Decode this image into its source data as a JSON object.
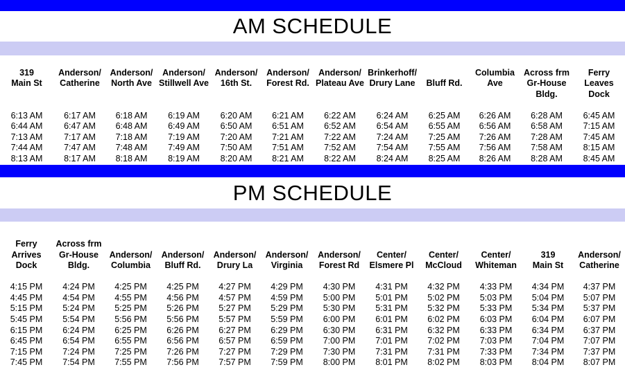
{
  "colors": {
    "rule_bar": "#0000FF",
    "band": "#CCCCF4",
    "text": "#000000",
    "background": "#FFFFFF"
  },
  "am_section": {
    "title": "AM SCHEDULE",
    "columns": [
      {
        "line1": "319",
        "line2": "Main St",
        "line3": ""
      },
      {
        "line1": "Anderson/",
        "line2": "Catherine",
        "line3": ""
      },
      {
        "line1": "Anderson/",
        "line2": "North Ave",
        "line3": ""
      },
      {
        "line1": "Anderson/",
        "line2": "Stillwell Ave",
        "line3": ""
      },
      {
        "line1": "Anderson/",
        "line2": "16th St.",
        "line3": ""
      },
      {
        "line1": "Anderson/",
        "line2": "Forest Rd.",
        "line3": ""
      },
      {
        "line1": "Anderson/",
        "line2": "Plateau Ave",
        "line3": ""
      },
      {
        "line1": "Brinkerhoff/",
        "line2": "Drury Lane",
        "line3": ""
      },
      {
        "line1": "",
        "line2": "Bluff Rd.",
        "line3": ""
      },
      {
        "line1": "Columbia",
        "line2": "Ave",
        "line3": ""
      },
      {
        "line1": "Across frm",
        "line2": "Gr-House",
        "line3": "Bldg."
      },
      {
        "line1": "Ferry",
        "line2": "Leaves",
        "line3": "Dock"
      }
    ],
    "rows": [
      [
        "6:13 AM",
        "6:17 AM",
        "6:18 AM",
        "6:19 AM",
        "6:20 AM",
        "6:21 AM",
        "6:22 AM",
        "6:24 AM",
        "6:25 AM",
        "6:26 AM",
        "6:28 AM",
        "6:45 AM"
      ],
      [
        "6:44 AM",
        "6:47 AM",
        "6:48 AM",
        "6:49 AM",
        "6:50 AM",
        "6:51 AM",
        "6:52 AM",
        "6:54 AM",
        "6:55 AM",
        "6:56 AM",
        "6:58 AM",
        "7:15 AM"
      ],
      [
        "7:13 AM",
        "7:17 AM",
        "7:18 AM",
        "7:19 AM",
        "7:20 AM",
        "7:21 AM",
        "7:22 AM",
        "7:24 AM",
        "7:25 AM",
        "7:26 AM",
        "7:28 AM",
        "7:45 AM"
      ],
      [
        "7:44 AM",
        "7:47 AM",
        "7:48 AM",
        "7:49 AM",
        "7:50 AM",
        "7:51 AM",
        "7:52 AM",
        "7:54 AM",
        "7:55 AM",
        "7:56 AM",
        "7:58 AM",
        "8:15 AM"
      ],
      [
        "8:13 AM",
        "8:17 AM",
        "8:18 AM",
        "8:19 AM",
        "8:20 AM",
        "8:21 AM",
        "8:22 AM",
        "8:24 AM",
        "8:25 AM",
        "8:26 AM",
        "8:28 AM",
        "8:45 AM"
      ]
    ]
  },
  "pm_section": {
    "title": "PM SCHEDULE",
    "columns": [
      {
        "line1": "Ferry",
        "line2": "Arrives",
        "line3": "Dock"
      },
      {
        "line1": "Across frm",
        "line2": "Gr-House",
        "line3": "Bldg."
      },
      {
        "line1": "",
        "line2": "Anderson/",
        "line3": "Columbia"
      },
      {
        "line1": "",
        "line2": "Anderson/",
        "line3": "Bluff Rd."
      },
      {
        "line1": "",
        "line2": "Anderson/",
        "line3": "Drury La"
      },
      {
        "line1": "",
        "line2": "Anderson/",
        "line3": "Virginia"
      },
      {
        "line1": "",
        "line2": "Anderson/",
        "line3": "Forest Rd"
      },
      {
        "line1": "",
        "line2": "Center/",
        "line3": "Elsmere Pl"
      },
      {
        "line1": "",
        "line2": "Center/",
        "line3": "McCloud"
      },
      {
        "line1": "",
        "line2": "Center/",
        "line3": "Whiteman"
      },
      {
        "line1": "",
        "line2": "319",
        "line3": "Main St"
      },
      {
        "line1": "",
        "line2": "Anderson/",
        "line3": "Catherine"
      }
    ],
    "rows": [
      [
        "4:15 PM",
        "4:24 PM",
        "4:25 PM",
        "4:25 PM",
        "4:27 PM",
        "4:29 PM",
        "4:30 PM",
        "4:31 PM",
        "4:32 PM",
        "4:33 PM",
        "4:34 PM",
        "4:37 PM"
      ],
      [
        "4:45 PM",
        "4:54 PM",
        "4:55 PM",
        "4:56 PM",
        "4:57 PM",
        "4:59 PM",
        "5:00 PM",
        "5:01 PM",
        "5:02 PM",
        "5:03 PM",
        "5:04 PM",
        "5:07 PM"
      ],
      [
        "5:15 PM",
        "5:24 PM",
        "5:25 PM",
        "5:26 PM",
        "5:27 PM",
        "5:29 PM",
        "5:30 PM",
        "5:31 PM",
        "5:32 PM",
        "5:33 PM",
        "5:34 PM",
        "5:37 PM"
      ],
      [
        "5:45 PM",
        "5:54 PM",
        "5:56 PM",
        "5:56 PM",
        "5:57 PM",
        "5:59 PM",
        "6:00 PM",
        "6:01 PM",
        "6:02 PM",
        "6:03 PM",
        "6:04 PM",
        "6:07 PM"
      ],
      [
        "6:15 PM",
        "6:24 PM",
        "6:25 PM",
        "6:26 PM",
        "6:27 PM",
        "6:29 PM",
        "6:30 PM",
        "6:31 PM",
        "6:32 PM",
        "6:33 PM",
        "6:34 PM",
        "6:37 PM"
      ],
      [
        "6:45 PM",
        "6:54 PM",
        "6:55 PM",
        "6:56 PM",
        "6:57 PM",
        "6:59 PM",
        "7:00 PM",
        "7:01 PM",
        "7:02 PM",
        "7:03 PM",
        "7:04 PM",
        "7:07 PM"
      ],
      [
        "7:15 PM",
        "7:24 PM",
        "7:25 PM",
        "7:26 PM",
        "7:27 PM",
        "7:29 PM",
        "7:30 PM",
        "7:31 PM",
        "7:31 PM",
        "7:33 PM",
        "7:34 PM",
        "7:37 PM"
      ],
      [
        "7:45 PM",
        "7:54 PM",
        "7:55 PM",
        "7:56 PM",
        "7:57 PM",
        "7:59 PM",
        "8:00 PM",
        "8:01 PM",
        "8:02 PM",
        "8:03 PM",
        "8:04 PM",
        "8:07 PM"
      ]
    ]
  }
}
